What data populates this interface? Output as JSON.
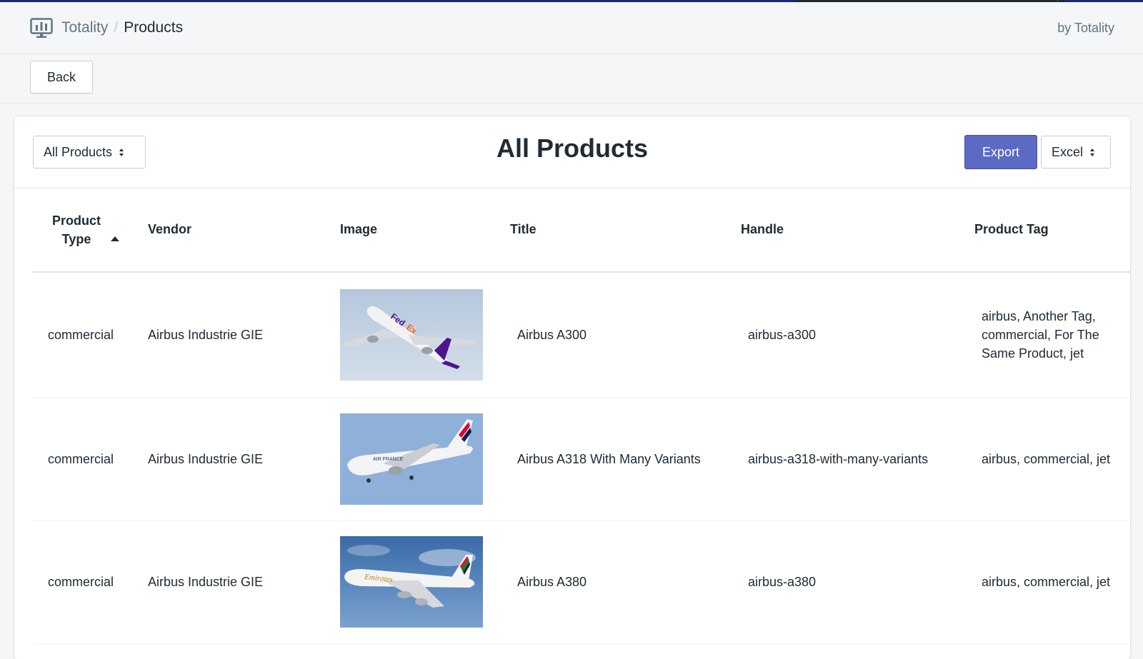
{
  "header": {
    "app_name": "Totality",
    "separator": "/",
    "page": "Products",
    "byline": "by Totality",
    "app_icon": "monitor-chart-icon"
  },
  "actions": {
    "back_label": "Back"
  },
  "card": {
    "title": "All Products",
    "filter_value": "All Products",
    "export_label": "Export",
    "format_value": "Excel"
  },
  "table": {
    "columns": [
      "Product Type",
      "Vendor",
      "Image",
      "Title",
      "Handle",
      "Product Tag"
    ],
    "sort": {
      "column": "Product Type",
      "direction": "ascending"
    },
    "rows": [
      {
        "type": "commercial",
        "vendor": "Airbus Industrie GIE",
        "image": "fedex-airbus-a300-photo",
        "title": "Airbus A300",
        "handle": "airbus-a300",
        "tags": "airbus, Another Tag, commercial, For The Same Product, jet"
      },
      {
        "type": "commercial",
        "vendor": "Airbus Industrie GIE",
        "image": "air-france-airbus-a318-photo",
        "title": "Airbus A318 With Many Variants",
        "handle": "airbus-a318-with-many-variants",
        "tags": "airbus, commercial, jet"
      },
      {
        "type": "commercial",
        "vendor": "Airbus Industrie GIE",
        "image": "emirates-airbus-a380-photo",
        "title": "Airbus A380",
        "handle": "airbus-a380",
        "tags": "airbus, commercial, jet"
      }
    ]
  },
  "colors": {
    "primary": "#5c6ac4",
    "accent_bar": "#1f2a6b",
    "background": "#f4f6f8"
  }
}
